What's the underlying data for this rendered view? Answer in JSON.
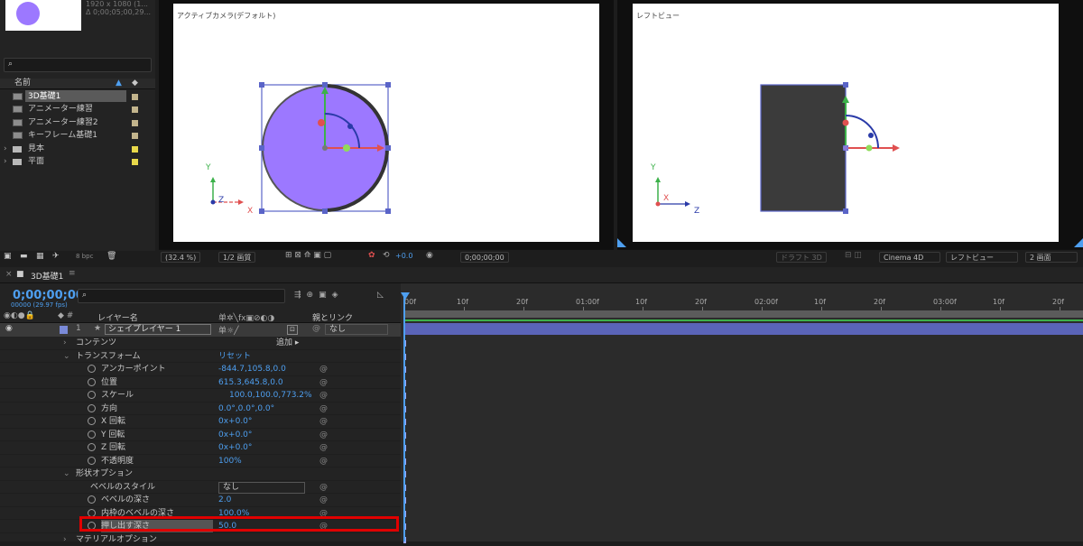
{
  "project": {
    "info_line1": "1920 x 1080 (1...",
    "info_line2": "Δ 0;00;05;00,29...",
    "search_icon": "search-icon",
    "col_name": "名前",
    "items": [
      {
        "name": "3D基礎1",
        "type": "comp",
        "color": "#c2b48c",
        "selected": true
      },
      {
        "name": "アニメーター練習",
        "type": "comp",
        "color": "#c2b48c",
        "selected": false
      },
      {
        "name": "アニメーター練習2",
        "type": "comp",
        "color": "#c2b48c",
        "selected": false
      },
      {
        "name": "キーフレーム基礎1",
        "type": "comp",
        "color": "#c2b48c",
        "selected": false
      },
      {
        "name": "見本",
        "type": "folder",
        "color": "#e8d84a",
        "selected": false
      },
      {
        "name": "平面",
        "type": "folder",
        "color": "#e8d84a",
        "selected": false
      }
    ],
    "bpc": "8 bpc"
  },
  "viewer1": {
    "label": "アクティブカメラ(デフォルト)",
    "zoom": "(32.4 %)",
    "resolution": "1/2 画質",
    "exposure": "+0.0",
    "timecode": "0;00;00;00"
  },
  "viewer2": {
    "label": "レフトビュー",
    "renderer": "Cinema 4D",
    "view": "レフトビュー",
    "layout": "2 画面",
    "draft3d": "ドラフト 3D"
  },
  "axes": {
    "x": "X",
    "y": "Y",
    "z": "Z"
  },
  "timeline": {
    "tab": "3D基礎1",
    "timecode": "0;00;00;00",
    "frames": "00000 (29.97 fps)",
    "col_layer_name": "レイヤー名",
    "col_parent": "親とリンク",
    "ruler": [
      "00f",
      "10f",
      "20f",
      "01:00f",
      "10f",
      "20f",
      "02:00f",
      "10f",
      "20f",
      "03:00f",
      "10f",
      "20f"
    ],
    "layer": {
      "num": "1",
      "name": "シェイプレイヤー 1",
      "parent": "なし"
    },
    "rows": [
      {
        "label": "コンテンツ",
        "value": "",
        "indent": 1,
        "add": "追加"
      },
      {
        "label": "トランスフォーム",
        "value": "リセット",
        "indent": 1
      },
      {
        "label": "アンカーポイント",
        "value": "-844.7,105.8,0.0",
        "indent": 2
      },
      {
        "label": "位置",
        "value": "615.3,645.8,0.0",
        "indent": 2
      },
      {
        "label": "スケール",
        "value": "100.0,100.0,773.2%",
        "indent": 2
      },
      {
        "label": "方向",
        "value": "0.0°,0.0°,0.0°",
        "indent": 2
      },
      {
        "label": "X 回転",
        "value": "0x+0.0°",
        "indent": 2
      },
      {
        "label": "Y 回転",
        "value": "0x+0.0°",
        "indent": 2
      },
      {
        "label": "Z 回転",
        "value": "0x+0.0°",
        "indent": 2
      },
      {
        "label": "不透明度",
        "value": "100%",
        "indent": 2
      },
      {
        "label": "形状オプション",
        "value": "",
        "indent": 1
      },
      {
        "label": "ベベルのスタイル",
        "value": "なし",
        "indent": 2
      },
      {
        "label": "ベベルの深さ",
        "value": "2.0",
        "indent": 2
      },
      {
        "label": "内枠のベベルの深さ",
        "value": "100.0%",
        "indent": 2
      },
      {
        "label": "押し出す深さ",
        "value": "50.0",
        "indent": 2
      },
      {
        "label": "マテリアルオプション",
        "value": "",
        "indent": 1
      }
    ]
  },
  "colors": {
    "accent": "#4e9ff0",
    "shape": "#9c78ff",
    "highlight": "#e00000"
  }
}
